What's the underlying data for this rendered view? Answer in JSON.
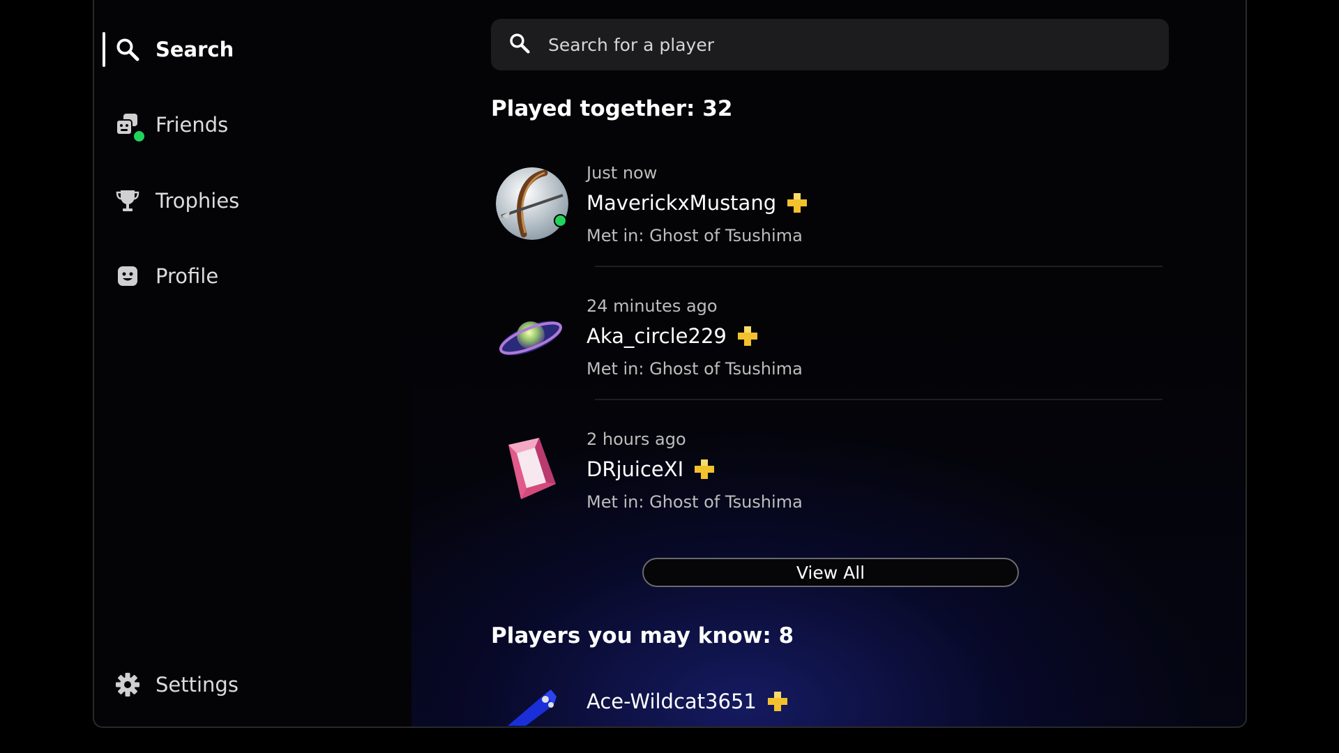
{
  "sidebar": {
    "items": [
      {
        "label": "Search",
        "icon": "search-icon",
        "active": true
      },
      {
        "label": "Friends",
        "icon": "friends-icon"
      },
      {
        "label": "Trophies",
        "icon": "trophy-icon"
      },
      {
        "label": "Profile",
        "icon": "profile-icon"
      }
    ],
    "settings": {
      "label": "Settings",
      "icon": "gear-icon"
    }
  },
  "search": {
    "placeholder": "Search for a player"
  },
  "played_together": {
    "title": "Played together: 32",
    "players": [
      {
        "time": "Just now",
        "name": "MaverickxMustang",
        "met": "Met in: Ghost of Tsushima",
        "plus": true,
        "online": true,
        "avatar": "bow-avatar"
      },
      {
        "time": "24 minutes ago",
        "name": "Aka_circle229",
        "met": "Met in: Ghost of Tsushima",
        "plus": true,
        "online": false,
        "avatar": "planet-avatar"
      },
      {
        "time": "2 hours ago",
        "name": "DRjuiceXI",
        "met": "Met in: Ghost of Tsushima",
        "plus": true,
        "online": false,
        "avatar": "gem-avatar"
      }
    ],
    "view_all_label": "View All"
  },
  "may_know": {
    "title": "Players you may know: 8",
    "players": [
      {
        "name": "Ace-Wildcat3651",
        "plus": true,
        "avatar": "skateboard-avatar"
      }
    ]
  },
  "colors": {
    "online": "#22d35b",
    "plus_gold": "#f2c12e",
    "accent_glow": "#181e6e"
  }
}
